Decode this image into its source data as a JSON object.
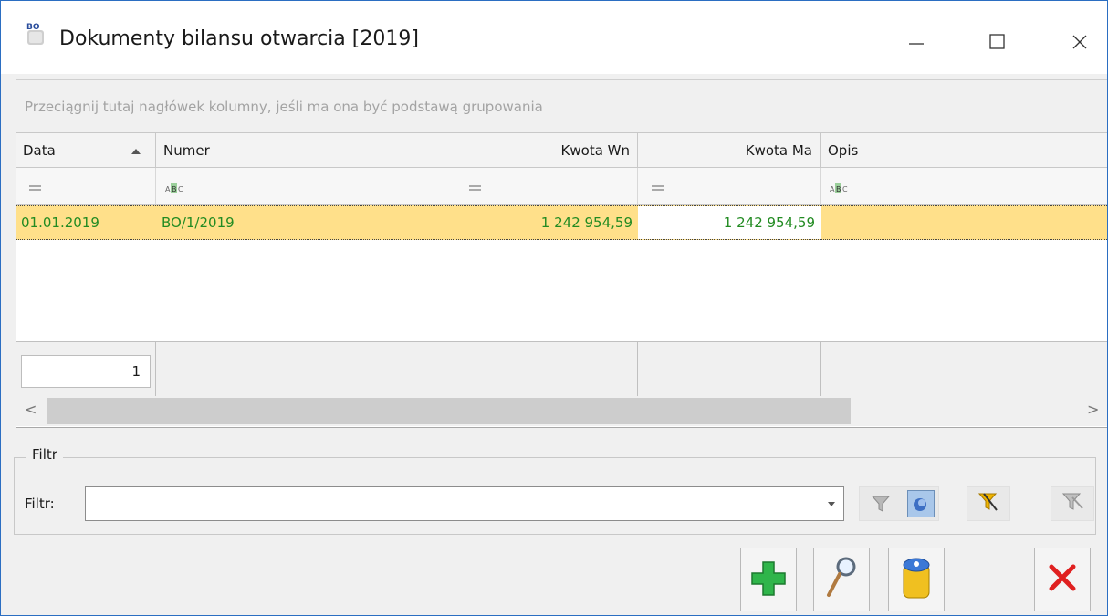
{
  "window": {
    "title": "Dokumenty bilansu otwarcia [2019]",
    "app_icon_badge": "BO",
    "minimize_label": "—",
    "maximize_label": "☐",
    "close_label": "✕"
  },
  "grid": {
    "group_hint": "Przeciągnij tutaj nagłówek kolumny, jeśli ma ona być podstawą grupowania",
    "columns": [
      "Data",
      "Numer",
      "Kwota Wn",
      "Kwota Ma",
      "Opis"
    ],
    "filter_row": [
      "=",
      "ABC",
      "=",
      "=",
      "ABC"
    ],
    "rows": [
      {
        "data": "01.01.2019",
        "numer": "BO/1/2019",
        "kwota_wn": "1 242 954,59",
        "kwota_ma": "1 242 954,59",
        "opis": ""
      }
    ],
    "footer_count": "1",
    "scroll_left": "<",
    "scroll_right": ">"
  },
  "filter": {
    "group_label": "Filtr",
    "label": "Filtr:",
    "value": ""
  },
  "colors": {
    "selected_row": "#ffe08a",
    "row_text": "#228b22",
    "window_border": "#2b6ec2"
  }
}
